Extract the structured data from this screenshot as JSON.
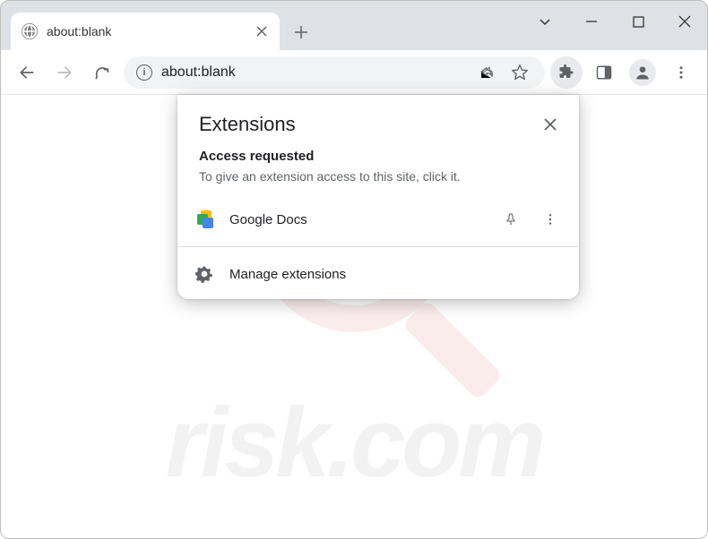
{
  "tab": {
    "title": "about:blank"
  },
  "address": {
    "url": "about:blank"
  },
  "popup": {
    "title": "Extensions",
    "access_heading": "Access requested",
    "access_text": "To give an extension access to this site, click it.",
    "extension_name": "Google Docs",
    "manage_label": "Manage extensions"
  },
  "watermark": {
    "text": "risk.com"
  }
}
